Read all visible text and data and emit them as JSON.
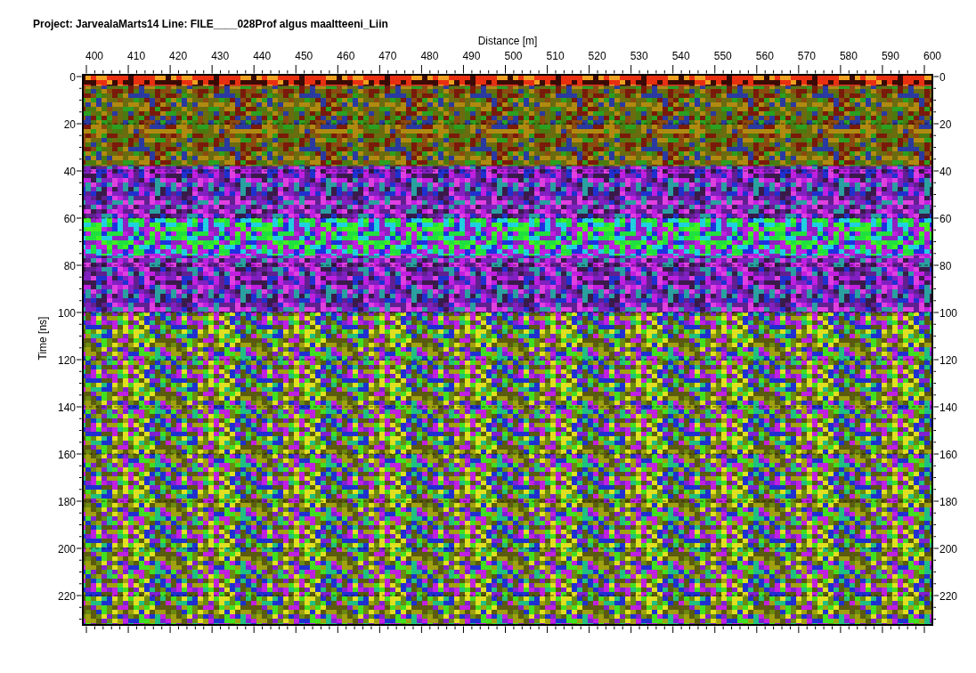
{
  "title": "Project: JarvealaMarts14  Line: FILE____028Prof algus maaltteeni_Liin",
  "x_axis": {
    "label": "Distance [m]",
    "ticks": [
      "400",
      "410",
      "420",
      "430",
      "440",
      "450",
      "460",
      "470",
      "480",
      "490",
      "500",
      "510",
      "520",
      "530",
      "540",
      "550",
      "560",
      "570",
      "580",
      "590",
      "600"
    ]
  },
  "y_axis": {
    "label": "Time [ns]",
    "ticks": [
      "0",
      "20",
      "40",
      "60",
      "80",
      "100",
      "120",
      "140",
      "160",
      "180",
      "200",
      "220"
    ]
  },
  "y_axis_right": {
    "ticks": [
      "0",
      "20",
      "40",
      "60",
      "80",
      "100",
      "120",
      "140",
      "160",
      "180",
      "200",
      "220"
    ]
  }
}
